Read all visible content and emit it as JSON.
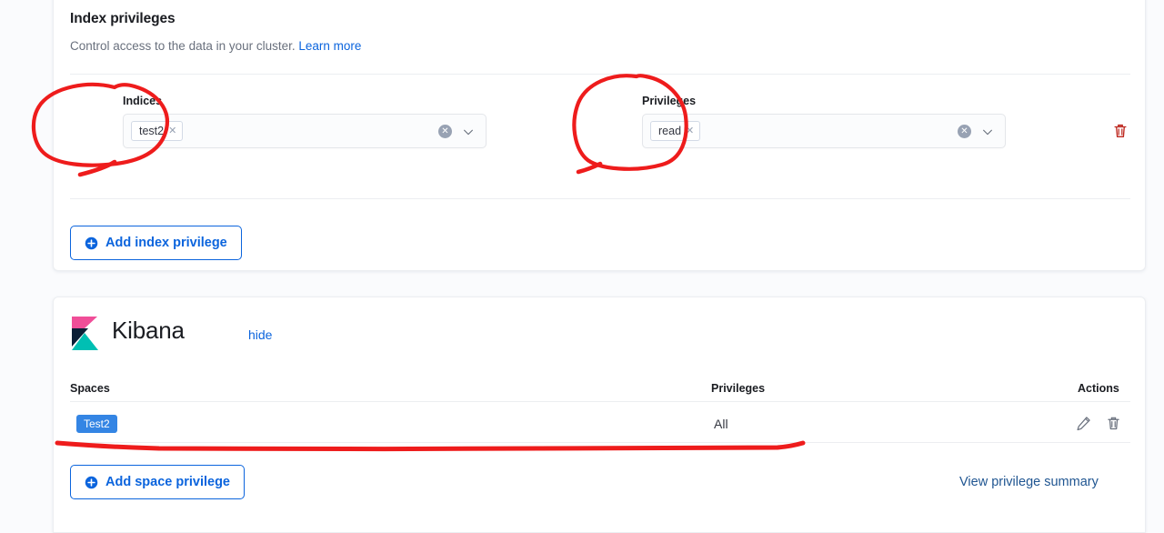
{
  "index_privileges": {
    "title": "Index privileges",
    "description_prefix": "Control access to the data in your cluster. ",
    "learn_more": "Learn more",
    "indices": {
      "label": "Indices",
      "pills": [
        "test2"
      ],
      "clear_icon": "clear-circle-icon",
      "caret_icon": "chevron-down-icon"
    },
    "privileges": {
      "label": "Privileges",
      "pills": [
        "read"
      ],
      "clear_icon": "clear-circle-icon",
      "caret_icon": "chevron-down-icon"
    },
    "delete_row_icon": "trash-icon",
    "add_button": "Add index privilege",
    "add_button_icon": "plus-in-circle-icon"
  },
  "kibana": {
    "logo_icon": "kibana-logo-icon",
    "title": "Kibana",
    "hide_label": "hide",
    "table": {
      "columns": [
        "Spaces",
        "Privileges",
        "Actions"
      ],
      "rows": [
        {
          "space": "Test2",
          "privilege": "All",
          "actions": [
            "pencil-icon",
            "trash-icon"
          ]
        }
      ]
    },
    "add_button": "Add space privilege",
    "add_button_icon": "plus-in-circle-icon",
    "summary_link": "View privilege summary"
  },
  "colors": {
    "link": "#0b64dd",
    "danger": "#bd271e",
    "badge_blue": "#3485e4",
    "annotation_red": "#ee1c1c",
    "panel_bg": "#ffffff",
    "page_bg": "#fafbfd"
  }
}
